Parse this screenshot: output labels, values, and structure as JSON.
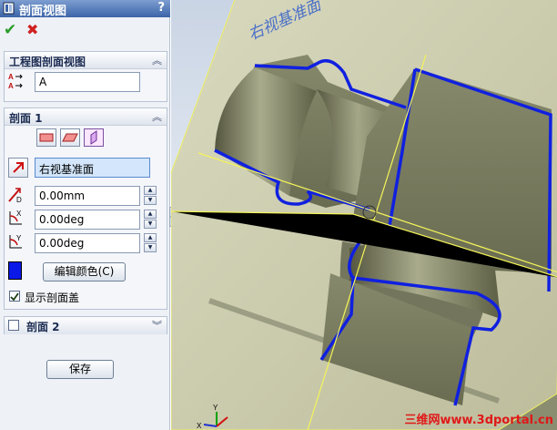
{
  "title_bar": {
    "title": "剖面视图",
    "help": "?"
  },
  "actions": {
    "ok": "✔",
    "cancel": "✖"
  },
  "drawing_view_group": {
    "title": "工程图剖面视图",
    "label_value": "A"
  },
  "section1_group": {
    "title": "剖面 1",
    "plane_value": "右视基准面",
    "distance_value": "0.00mm",
    "x_rotation_value": "0.00deg",
    "y_rotation_value": "0.00deg",
    "edit_color_label": "编辑颜色(C)",
    "show_section_cap_label": "显示剖面盖",
    "show_section_cap_checked": true,
    "section_color": "#0a18e8"
  },
  "section2_group": {
    "title": "剖面 2"
  },
  "save_button_label": "保存",
  "graphics": {
    "plane_label": "右视基准面",
    "triad_y": "Y",
    "triad_x": "X",
    "watermark": "三维网www.3dportal.cn"
  },
  "colors": {
    "accent": "#3b64a8",
    "section_edge": "#1020e0",
    "part_body": "#7a7d62",
    "plane": "#c8c8a8"
  }
}
